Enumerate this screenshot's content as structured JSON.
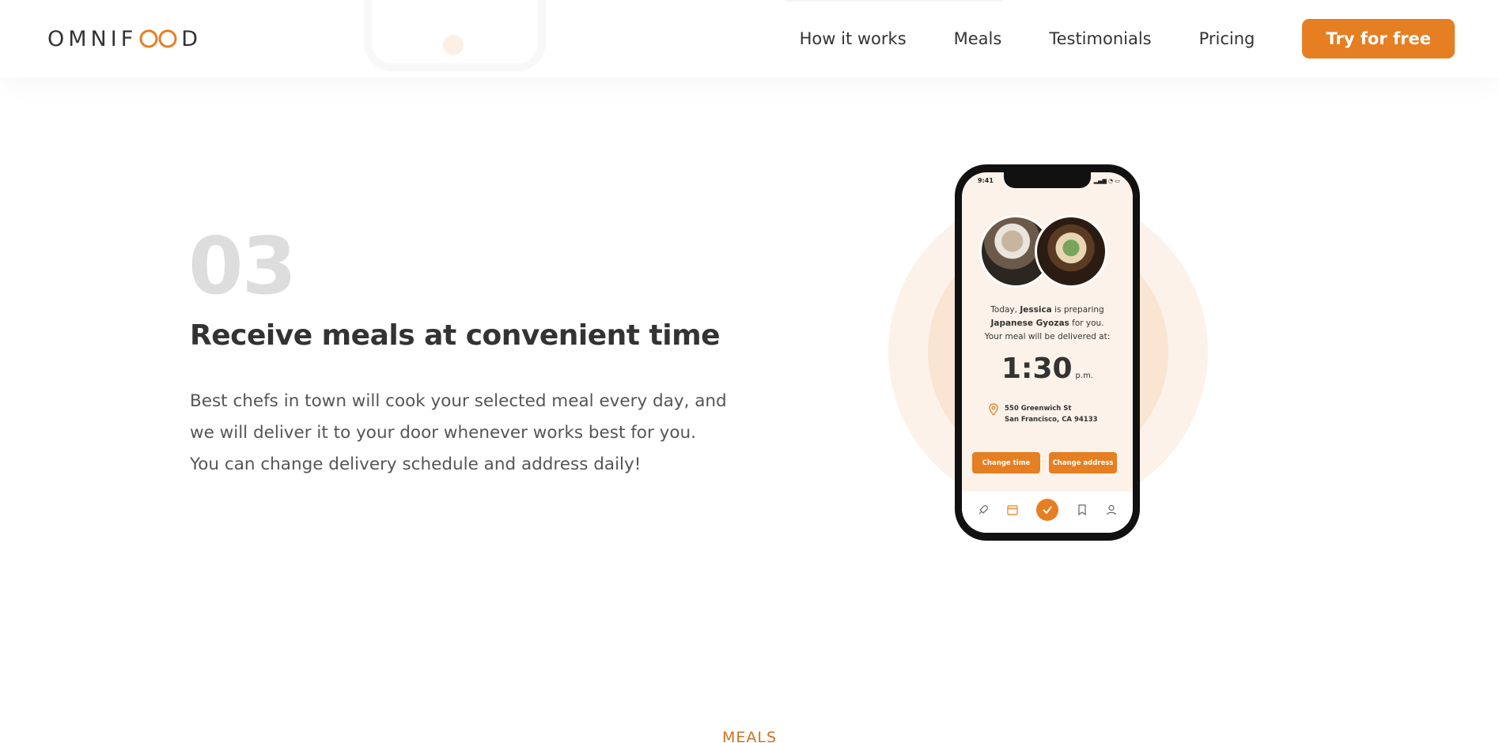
{
  "header": {
    "logo_left": "OMNIF",
    "logo_right": "D",
    "nav": [
      {
        "label": "How it works"
      },
      {
        "label": "Meals"
      },
      {
        "label": "Testimonials"
      },
      {
        "label": "Pricing"
      }
    ],
    "cta_label": "Try for free"
  },
  "step": {
    "number": "03",
    "title": "Receive meals at convenient time",
    "description": "Best chefs in town will cook your selected meal every day, and we will deliver it to your door whenever works best for you. You can change delivery schedule and address daily!"
  },
  "phone": {
    "status_time": "9:41",
    "msg_line1_pre": "Today, ",
    "chef_name": "Jessica",
    "msg_line1_post": " is preparing",
    "dish": "Japanese Gyozas",
    "msg_line2_post": " for you.",
    "msg_line3": "Your meal will be delivered at:",
    "time": "1:30",
    "time_suffix": "p.m.",
    "address_line1": "550 Greenwich St",
    "address_line2": "San Francisco, CA 94133",
    "btn_change_time": "Change time",
    "btn_change_address": "Change address"
  },
  "next_section": {
    "subheading": "MEALS"
  },
  "colors": {
    "accent": "#e67e22",
    "accent_light": "#fdf2e9",
    "accent_mid": "#fae5d3",
    "step_number": "#dddddd"
  }
}
